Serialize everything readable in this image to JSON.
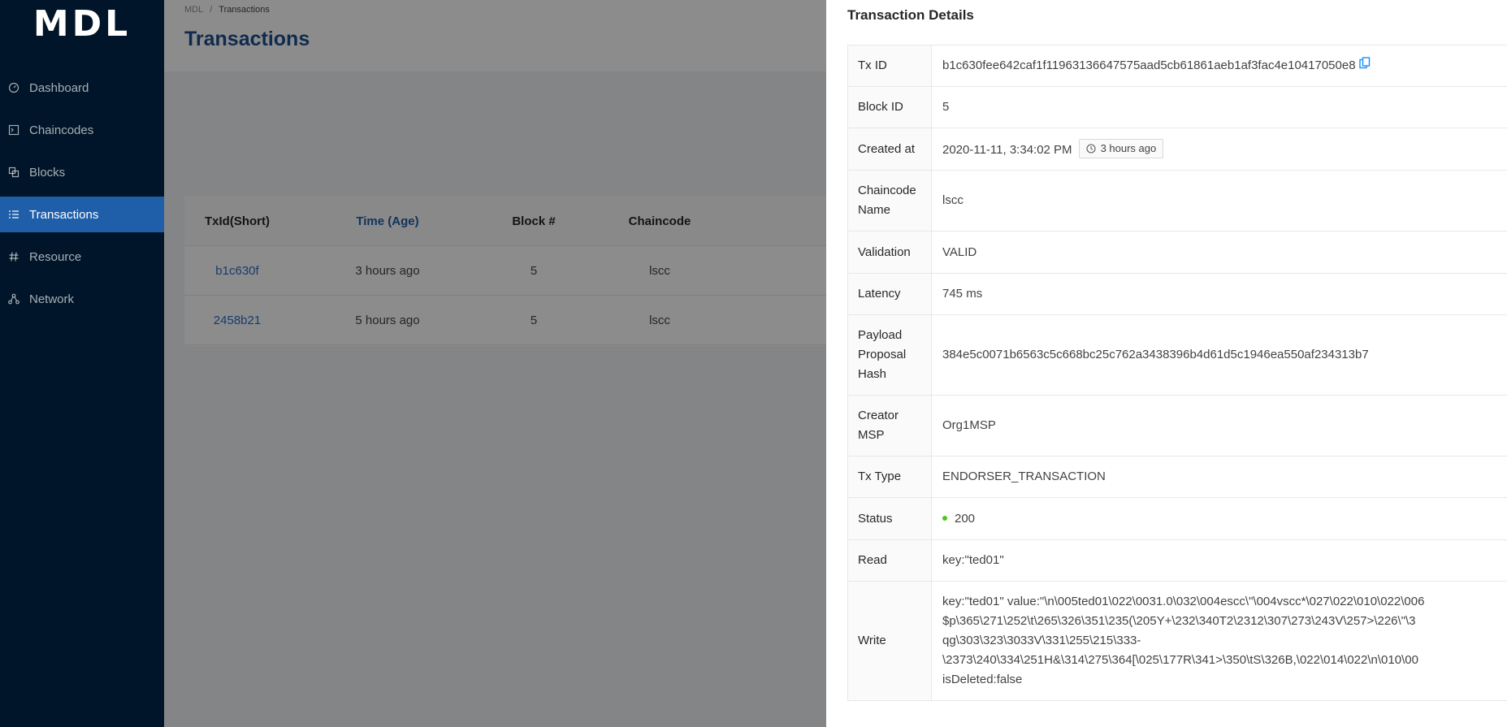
{
  "app": {
    "logo": "MDL"
  },
  "sidebar": {
    "items": [
      {
        "label": "Dashboard",
        "icon": "dashboard-icon",
        "active": false
      },
      {
        "label": "Chaincodes",
        "icon": "code-icon",
        "active": false
      },
      {
        "label": "Blocks",
        "icon": "blocks-icon",
        "active": false
      },
      {
        "label": "Transactions",
        "icon": "list-icon",
        "active": true
      },
      {
        "label": "Resource",
        "icon": "number-icon",
        "active": false
      },
      {
        "label": "Network",
        "icon": "network-icon",
        "active": false
      }
    ]
  },
  "header": {
    "breadcrumb": [
      "MDL",
      "Transactions"
    ],
    "title": "Transactions"
  },
  "table": {
    "columns": [
      "TxId(Short)",
      "Time (Age)",
      "Block #",
      "Chaincode"
    ],
    "sorted_column": "Time (Age)",
    "rows": [
      {
        "txid": "b1c630f",
        "time": "3 hours ago",
        "block": "5",
        "chaincode": "lscc"
      },
      {
        "txid": "2458b21",
        "time": "5 hours ago",
        "block": "5",
        "chaincode": "lscc"
      }
    ]
  },
  "drawer": {
    "title": "Transaction Details",
    "rows": {
      "tx_id": {
        "label": "Tx ID",
        "value": "b1c630fee642caf1f11963136647575aad5cb61861aeb1af3fac4e10417050e8"
      },
      "block_id": {
        "label": "Block ID",
        "value": "5"
      },
      "created_at": {
        "label": "Created at",
        "value": "2020-11-11, 3:34:02 PM",
        "age": "3 hours ago"
      },
      "chaincode_name": {
        "label": "Chaincode Name",
        "value": "lscc"
      },
      "validation": {
        "label": "Validation",
        "value": "VALID"
      },
      "latency": {
        "label": "Latency",
        "value": "745 ms"
      },
      "payload_hash": {
        "label": "Payload Proposal Hash",
        "value": "384e5c0071b6563c5c668bc25c762a3438396b4d61d5c1946ea550af234313b7"
      },
      "creator_msp": {
        "label": "Creator MSP",
        "value": "Org1MSP"
      },
      "tx_type": {
        "label": "Tx Type",
        "value": "ENDORSER_TRANSACTION"
      },
      "status": {
        "label": "Status",
        "value": "200"
      },
      "read": {
        "label": "Read",
        "value": "key:\"ted01\""
      },
      "write": {
        "label": "Write",
        "lines": [
          "key:\"ted01\" value:\"\\n\\005ted01\\022\\0031.0\\032\\004escc\\\"\\004vscc*\\027\\022\\010\\022\\006",
          "$p\\365\\271\\252\\t\\265\\326\\351\\235(\\205Y+\\232\\340T2\\2312\\307\\273\\243V\\257>\\226\\\"\\3",
          "qg\\303\\323\\3033V\\331\\255\\215\\333-",
          "\\2373\\240\\334\\251H&\\314\\275\\364[\\025\\177R\\341>\\350\\tS\\326B,\\022\\014\\022\\n\\010\\00",
          "isDeleted:false"
        ]
      }
    }
  },
  "colors": {
    "sidebar_bg": "#001529",
    "active_item": "#1f5faa",
    "title": "#1d4f91",
    "link": "#2a6ec6",
    "status_ok": "#52c41a"
  }
}
